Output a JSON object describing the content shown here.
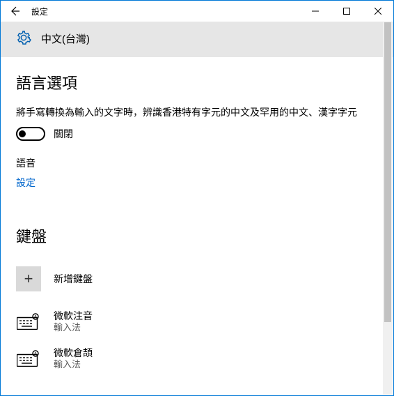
{
  "titlebar": {
    "title": "設定"
  },
  "header": {
    "language_name": "中文(台灣)"
  },
  "lang_options": {
    "heading": "語言選項",
    "handwriting_desc": "將手寫轉換為輸入的文字時，辨識香港特有字元的中文及罕用的中文、漢字字元",
    "toggle_state": "關閉",
    "speech_label": "語音",
    "settings_link": "設定"
  },
  "keyboards": {
    "heading": "鍵盤",
    "add_label": "新增鍵盤",
    "items": [
      {
        "name": "微軟注音",
        "sub": "輸入法"
      },
      {
        "name": "微軟倉頡",
        "sub": "輸入法"
      }
    ]
  }
}
